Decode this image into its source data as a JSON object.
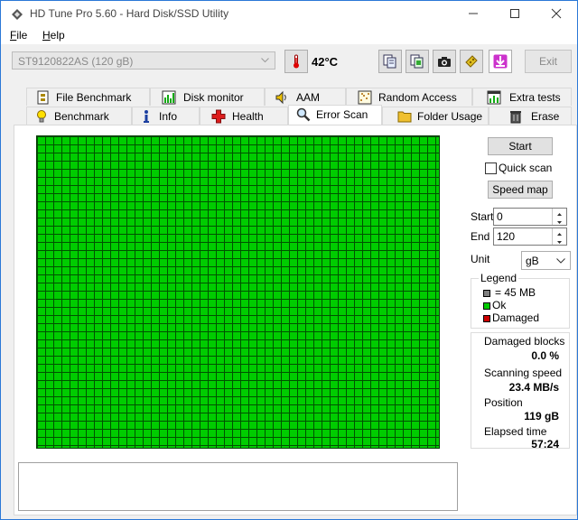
{
  "window": {
    "title": "HD Tune Pro 5.60 - Hard Disk/SSD Utility",
    "accent": "#2b78d7"
  },
  "menu": {
    "file": {
      "mnemonic": "F",
      "rest": "ile"
    },
    "help": {
      "mnemonic": "H",
      "rest": "elp"
    }
  },
  "toolbar": {
    "drive": "ST9120822AS (120 gB)",
    "temperature": "42°C",
    "exit_label": "Exit",
    "icons": [
      "copy-text-icon",
      "copy-screenshot-icon",
      "camera-icon",
      "save-icon",
      "download-icon"
    ]
  },
  "tabs": {
    "top": [
      {
        "label": "File Benchmark",
        "icon": "file-benchmark-icon"
      },
      {
        "label": "Disk monitor",
        "icon": "disk-monitor-icon"
      },
      {
        "label": "AAM",
        "icon": "speaker-icon"
      },
      {
        "label": "Random Access",
        "icon": "random-access-icon"
      },
      {
        "label": "Extra tests",
        "icon": "extra-tests-icon"
      }
    ],
    "bottom": [
      {
        "label": "Benchmark",
        "icon": "lightbulb-icon"
      },
      {
        "label": "Info",
        "icon": "info-icon"
      },
      {
        "label": "Health",
        "icon": "health-cross-icon"
      },
      {
        "label": "Error Scan",
        "icon": "magnifier-icon",
        "active": true
      },
      {
        "label": "Folder Usage",
        "icon": "folder-icon"
      },
      {
        "label": "Erase",
        "icon": "trash-icon"
      }
    ]
  },
  "scan": {
    "block_color": "#00cc00",
    "block_status": "Ok",
    "start_button": "Start",
    "quick_scan_label": "Quick scan",
    "quick_scan_checked": false,
    "speed_map_button": "Speed map",
    "start_label": "Start",
    "start_value": "0",
    "end_label": "End",
    "end_value": "120",
    "unit_label": "Unit",
    "unit_value": "gB"
  },
  "legend": {
    "title": "Legend",
    "block_size": "= 45 MB",
    "ok": "Ok",
    "damaged": "Damaged",
    "colors": {
      "block": "#808080",
      "ok": "#00cc00",
      "damaged": "#cc0000"
    }
  },
  "stats": {
    "damaged_blocks_label": "Damaged blocks",
    "damaged_blocks_value": "0.0 %",
    "scanning_speed_label": "Scanning speed",
    "scanning_speed_value": "23.4 MB/s",
    "position_label": "Position",
    "position_value": "119 gB",
    "elapsed_label": "Elapsed time",
    "elapsed_value": "57:24"
  },
  "log": {
    "text": ""
  }
}
